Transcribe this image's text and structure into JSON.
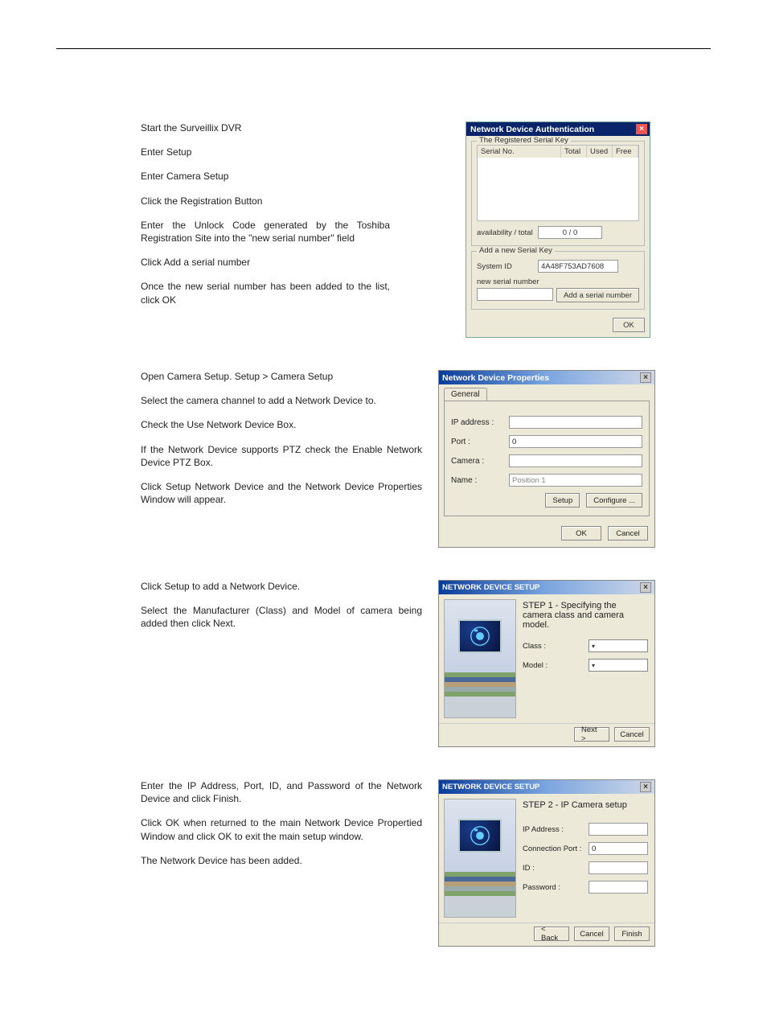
{
  "instructions": {
    "block1": [
      "Start the Surveillix DVR",
      "Enter Setup",
      "Enter Camera Setup",
      "Click the Registration Button",
      "Enter the Unlock Code generated by the Toshiba Registration Site into the \"new serial number\" field",
      "Click Add a serial number",
      "Once the new serial number has been added to the list, click OK"
    ],
    "block2": [
      "Open Camera Setup.  Setup > Camera Setup",
      "Select the camera channel to add a Network Device to.",
      "Check the Use Network Device Box.",
      "If the Network Device supports PTZ check the Enable Network Device PTZ Box.",
      "Click Setup Network Device and the Network Device Properties Window will appear."
    ],
    "block3": [
      "Click Setup to add a Network Device.",
      "Select the Manufacturer (Class) and Model of camera being added then click Next."
    ],
    "block4": [
      "Enter the IP Address, Port, ID, and Password of the Network Device and click Finish.",
      "Click OK when returned to the main Network Device Propertied Window and click OK to exit the main setup window.",
      "The Network Device has been added."
    ]
  },
  "dialog1": {
    "title": "Network Device Authentication",
    "legend1": "The Registered Serial Key",
    "columns": {
      "serial": "Serial No.",
      "total": "Total",
      "used": "Used",
      "free": "Free"
    },
    "avail_label": "availability / total",
    "avail_value": "0 / 0",
    "legend2": "Add a new Serial Key",
    "system_id_label": "System ID",
    "system_id_value": "4A48F753AD7608",
    "newserial_label": "new serial number",
    "newserial_value": "",
    "add_btn": "Add a serial number",
    "ok_btn": "OK"
  },
  "dialog2": {
    "title": "Network Device Properties",
    "tab": "General",
    "ip_label": "IP address :",
    "ip_value": "",
    "port_label": "Port :",
    "port_value": "0",
    "camera_label": "Camera :",
    "camera_value": "",
    "name_label": "Name :",
    "name_value": "Position 1",
    "setup_btn": "Setup",
    "configure_btn": "Configure ...",
    "ok_btn": "OK",
    "cancel_btn": "Cancel"
  },
  "dialog3": {
    "title": "NETWORK DEVICE SETUP",
    "heading": "STEP 1 -  Specifying the camera class and camera model.",
    "class_label": "Class :",
    "model_label": "Model :",
    "next_btn": "Next >",
    "cancel_btn": "Cancel"
  },
  "dialog4": {
    "title": "NETWORK DEVICE SETUP",
    "heading": "STEP 2 -  IP Camera setup",
    "ip_label": "IP Address :",
    "ip_value": "",
    "port_label": "Connection Port :",
    "port_value": "0",
    "id_label": "ID :",
    "id_value": "",
    "pw_label": "Password :",
    "pw_value": "",
    "back_btn": "< Back",
    "cancel_btn": "Cancel",
    "finish_btn": "Finish"
  }
}
